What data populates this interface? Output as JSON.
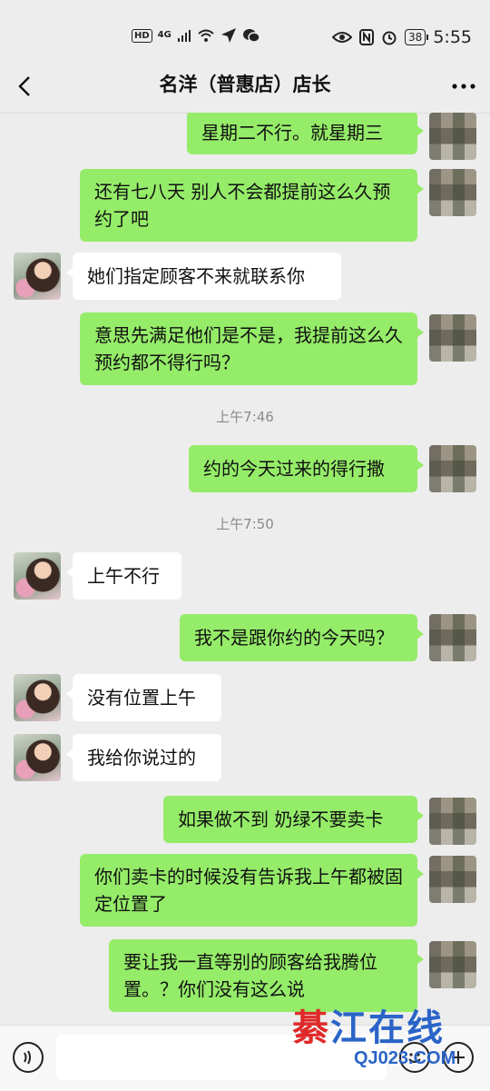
{
  "status_bar": {
    "hd": "HD",
    "network": "4G",
    "battery": "38",
    "time": "5:55"
  },
  "header": {
    "title": "名洋（普惠店）店长",
    "back_icon": "chevron-left-icon",
    "more_icon": "more-dots-icon"
  },
  "messages": [
    {
      "from": "me",
      "text": "星期二不行。就星期三"
    },
    {
      "from": "me",
      "text": "还有七八天 别人不会都提前这么久预约了吧"
    },
    {
      "from": "them",
      "text": "她们指定顾客不来就联系你"
    },
    {
      "from": "me",
      "text": "意思先满足他们是不是，我提前这么久预约都不得行吗？"
    },
    {
      "timestamp": "上午7:46"
    },
    {
      "from": "me",
      "text": "约的今天过来的得行撒"
    },
    {
      "timestamp": "上午7:50"
    },
    {
      "from": "them",
      "text": "上午不行"
    },
    {
      "from": "me",
      "text": "我不是跟你约的今天吗？"
    },
    {
      "from": "them",
      "text": "没有位置上午"
    },
    {
      "from": "them",
      "text": "我给你说过的"
    },
    {
      "from": "me",
      "text": "如果做不到 奶绿不要卖卡"
    },
    {
      "from": "me",
      "text": "你们卖卡的时候没有告诉我上午都被固定位置了"
    },
    {
      "from": "me",
      "text": "要让我一直等别的顾客给我腾位置。？你们没有这么说"
    }
  ],
  "input_bar": {
    "voice_icon": "voice-icon",
    "emoji_icon": "emoji-icon",
    "plus_icon": "plus-icon"
  },
  "watermark": {
    "title_a": "綦",
    "title_b": "江在线",
    "url": "QJ023.COM"
  },
  "colors": {
    "my_bubble": "#95ec69",
    "their_bubble": "#ffffff",
    "background": "#ededed"
  }
}
